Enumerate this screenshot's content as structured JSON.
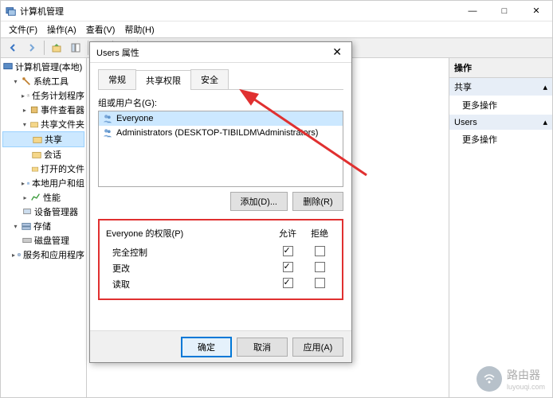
{
  "main_window": {
    "title": "计算机管理",
    "win_controls": {
      "min": "—",
      "max": "□",
      "close": "✕"
    }
  },
  "menu": {
    "file": "文件(F)",
    "action": "操作(A)",
    "view": "查看(V)",
    "help": "帮助(H)"
  },
  "tree": {
    "root": "计算机管理(本地)",
    "system_tools": "系统工具",
    "task_scheduler": "任务计划程序",
    "event_viewer": "事件查看器",
    "shared_folders": "共享文件夹",
    "shares": "共享",
    "sessions": "会话",
    "open_files": "打开的文件",
    "local_users": "本地用户和组",
    "performance": "性能",
    "device_manager": "设备管理器",
    "storage": "存储",
    "disk_management": "磁盘管理",
    "services_apps": "服务和应用程序"
  },
  "actions": {
    "header": "操作",
    "section1": "共享",
    "more_actions": "更多操作",
    "section2": "Users"
  },
  "dialog": {
    "title": "Users 属性",
    "close": "✕",
    "tabs": {
      "general": "常规",
      "share_perms": "共享权限",
      "security": "安全"
    },
    "group_label": "组或用户名(G):",
    "users": [
      {
        "name": "Everyone"
      },
      {
        "name": "Administrators (DESKTOP-TIBILDM\\Administrators)"
      }
    ],
    "add_btn": "添加(D)...",
    "remove_btn": "删除(R)",
    "perm_header": "Everyone 的权限(P)",
    "allow": "允许",
    "deny": "拒绝",
    "perms": [
      {
        "name": "完全控制",
        "allow": true,
        "deny": false
      },
      {
        "name": "更改",
        "allow": true,
        "deny": false
      },
      {
        "name": "读取",
        "allow": true,
        "deny": false
      }
    ],
    "ok": "确定",
    "cancel": "取消",
    "apply": "应用(A)"
  },
  "watermark": {
    "text": "路由器",
    "sub": "luyouqi.com"
  }
}
